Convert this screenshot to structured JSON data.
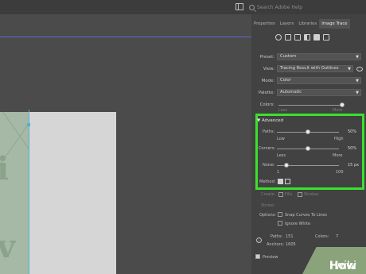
{
  "topbar": {
    "search_placeholder": "Search Adobe Help"
  },
  "panel": {
    "tabs": [
      {
        "label": "Properties"
      },
      {
        "label": "Layers"
      },
      {
        "label": "Libraries"
      },
      {
        "label": "Image Trace"
      }
    ],
    "preset": {
      "label": "Preset:",
      "value": "Custom"
    },
    "view": {
      "label": "View:",
      "value": "Tracing Result with Outlines"
    },
    "mode": {
      "label": "Mode:",
      "value": "Color"
    },
    "palette": {
      "label": "Palette:",
      "value": "Automatic"
    },
    "colors": {
      "label": "Colors:",
      "level": 1.0,
      "left": "Less",
      "right": "More"
    },
    "advanced": {
      "title": "Advanced",
      "paths": {
        "label": "Paths:",
        "value": "50%",
        "level": 0.5,
        "low": "Low",
        "high": "High"
      },
      "corners": {
        "label": "Corners:",
        "value": "50%",
        "level": 0.5,
        "low": "Less",
        "high": "More"
      },
      "noise": {
        "label": "Noise:",
        "value": "15 px",
        "level": 0.15,
        "min": "1",
        "max": "100"
      },
      "method": {
        "label": "Method:"
      }
    },
    "create": {
      "label": "Create:",
      "fills": "Fills",
      "strokes": "Strokes"
    },
    "stroke": {
      "label": "Stroke:"
    },
    "options": {
      "label": "Options:",
      "snap": "Snap Curves To Lines",
      "ignore_white": "Ignore White"
    },
    "stats": {
      "paths_label": "Paths:",
      "paths_value": "151",
      "colors_label": "Colors:",
      "colors_value": "7",
      "anchors_label": "Anchors:",
      "anchors_value": "1605"
    },
    "preview": {
      "label": "Preview",
      "checked": true
    }
  },
  "canvas": {
    "letters": [
      "i",
      "v"
    ]
  },
  "watermark": {
    "wiki": "wiki",
    "how": "How"
  },
  "colors": {
    "highlight": "#3be12c",
    "selection": "#53b0d6",
    "watermark_bg": "#8aa37a"
  }
}
